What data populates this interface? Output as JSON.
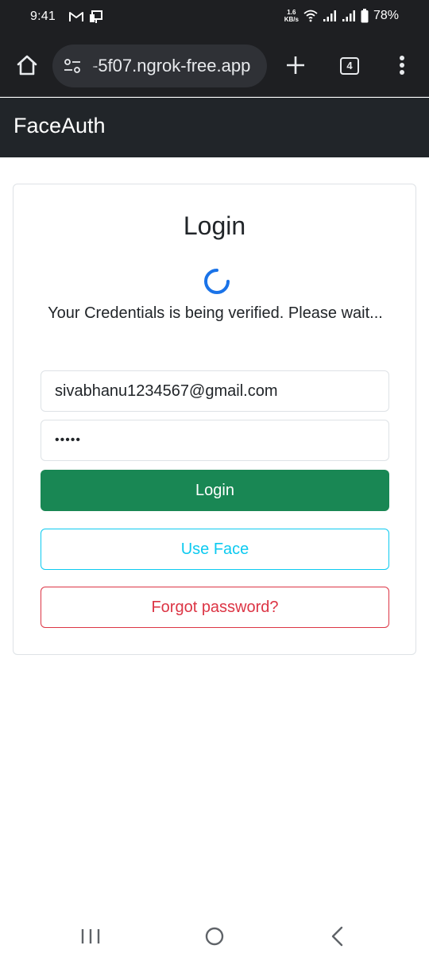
{
  "status_bar": {
    "time": "9:41",
    "net_speed_value": "1.6",
    "net_speed_unit": "KB/s",
    "battery": "78%"
  },
  "browser": {
    "url": "-5f07.ngrok-free.app",
    "tab_count": "4"
  },
  "navbar": {
    "brand": "FaceAuth"
  },
  "login_card": {
    "title": "Login",
    "status_message": "Your Credentials is being verified. Please wait...",
    "email_value": "sivabhanu1234567@gmail.com",
    "password_value": "•••••",
    "login_button": "Login",
    "use_face_button": "Use Face",
    "forgot_password_button": "Forgot password?"
  },
  "colors": {
    "success": "#198754",
    "info": "#0dcaf0",
    "danger": "#dc3545",
    "spinner": "#1a73e8",
    "navbar": "#212529"
  },
  "icons": {
    "gmail": "gmail-icon",
    "cast": "device-icon",
    "wifi": "wifi-icon",
    "signal": "signal-icon",
    "battery": "battery-icon",
    "home": "home-icon",
    "site_settings": "tune-icon",
    "new_tab": "plus-icon",
    "menu": "more-vert-icon",
    "recents": "recents-icon",
    "home_nav": "home-circle-icon",
    "back": "back-icon"
  }
}
